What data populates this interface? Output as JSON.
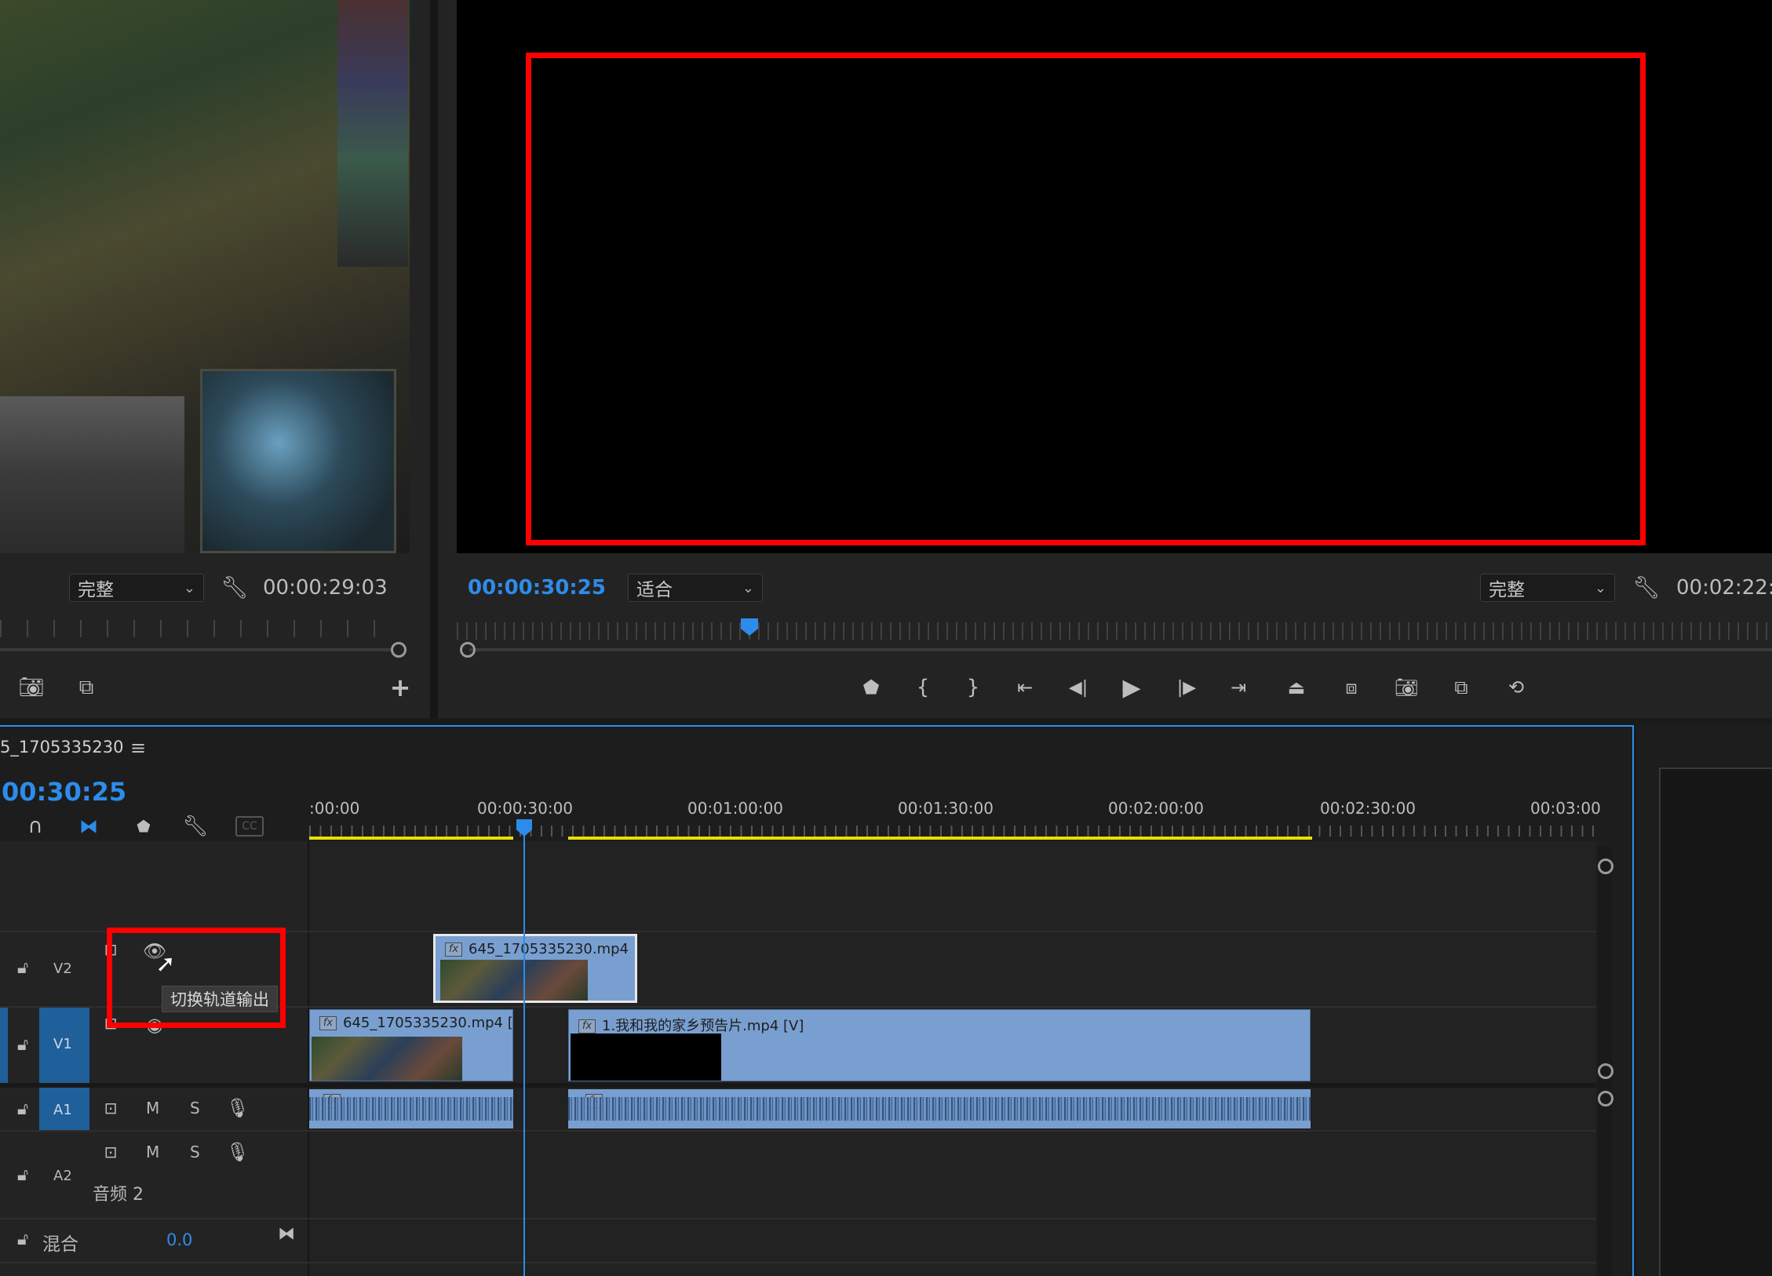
{
  "source_monitor": {
    "quality": "完整",
    "timecode": "00:00:29:03"
  },
  "program_monitor": {
    "timecode": "00:00:30:25",
    "zoom": "适合",
    "quality": "完整",
    "duration": "00:02:22:"
  },
  "timeline": {
    "sequence_name": "5_1705335230",
    "menu_icon": "hamburger-icon",
    "current_time": "00:30:25",
    "ruler_labels": [
      ":00:00",
      "00:00:30:00",
      "00:01:00:00",
      "00:01:30:00",
      "00:02:00:00",
      "00:02:30:00",
      "00:03:00"
    ],
    "tracks": {
      "v2": {
        "name": "V2"
      },
      "v1": {
        "name": "V1"
      },
      "a1": {
        "name": "A1",
        "mute": "M",
        "solo": "S"
      },
      "a2": {
        "name": "A2",
        "mute": "M",
        "solo": "S",
        "label": "音频 2"
      },
      "mix": {
        "label": "混合",
        "value": "0.0"
      }
    },
    "clips": {
      "v2_clip": "645_1705335230.mp4",
      "v1_clip_a": "645_1705335230.mp4 [",
      "v1_clip_b": "1.我和我的家乡预告片.mp4 [V]",
      "fx": "fx"
    },
    "tooltip": "切换轨道输出"
  },
  "colors": {
    "accent_blue": "#2d8ceb",
    "clip_blue": "#789fd0",
    "highlight_red": "#ff0000",
    "work_area_yellow": "#e8e000"
  }
}
